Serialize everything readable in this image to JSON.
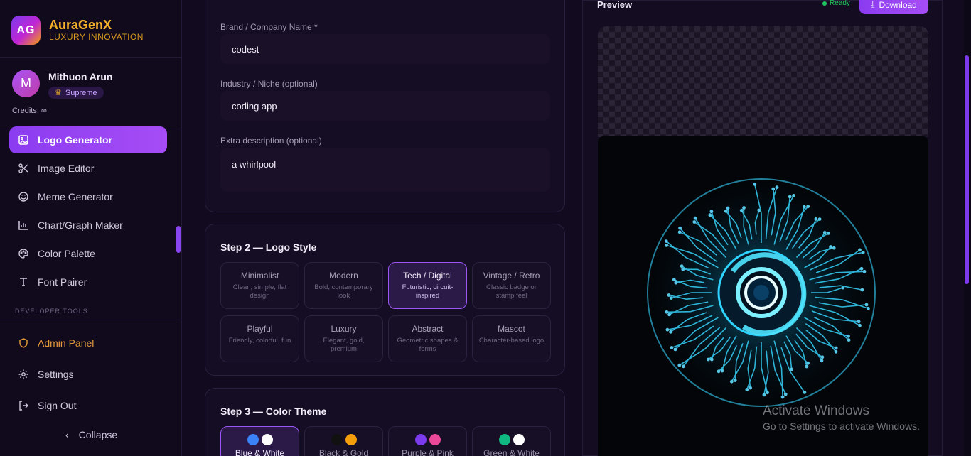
{
  "brand": {
    "logo_text": "AG",
    "name": "AuraGenX",
    "tagline": "LUXURY INNOVATION"
  },
  "user": {
    "initial": "M",
    "name": "Mithuon Arun",
    "badge": "Supreme",
    "credits": "Credits: ∞"
  },
  "nav": {
    "items": [
      {
        "label": "Logo Generator",
        "icon": "image-icon",
        "active": true
      },
      {
        "label": "Image Editor",
        "icon": "scissors-icon"
      },
      {
        "label": "Meme Generator",
        "icon": "smile-icon"
      },
      {
        "label": "Chart/Graph Maker",
        "icon": "bar-chart-icon"
      },
      {
        "label": "Color Palette",
        "icon": "palette-icon"
      },
      {
        "label": "Font Pairer",
        "icon": "type-icon"
      }
    ],
    "section_label": "DEVELOPER TOOLS",
    "bottom": [
      {
        "label": "Admin Panel",
        "icon": "shield-icon"
      },
      {
        "label": "Settings",
        "icon": "gear-icon"
      },
      {
        "label": "Sign Out",
        "icon": "sign-out-icon"
      }
    ],
    "collapse_label": "Collapse"
  },
  "form": {
    "brand_label": "Brand / Company Name *",
    "brand_value": "codest",
    "industry_label": "Industry / Niche (optional)",
    "industry_value": "coding app",
    "extra_label": "Extra description (optional)",
    "extra_value": "a whirlpool"
  },
  "step2": {
    "title": "Step 2 — Logo Style",
    "options": [
      {
        "title": "Minimalist",
        "desc": "Clean, simple, flat design"
      },
      {
        "title": "Modern",
        "desc": "Bold, contemporary look"
      },
      {
        "title": "Tech / Digital",
        "desc": "Futuristic, circuit-inspired",
        "selected": true
      },
      {
        "title": "Vintage / Retro",
        "desc": "Classic badge or stamp feel"
      },
      {
        "title": "Playful",
        "desc": "Friendly, colorful, fun"
      },
      {
        "title": "Luxury",
        "desc": "Elegant, gold, premium"
      },
      {
        "title": "Abstract",
        "desc": "Geometric shapes & forms"
      },
      {
        "title": "Mascot",
        "desc": "Character-based logo"
      }
    ]
  },
  "step3": {
    "title": "Step 3 — Color Theme",
    "themes": [
      {
        "label": "Blue & White",
        "colors": [
          "#3b82f6",
          "#ffffff"
        ],
        "selected": true
      },
      {
        "label": "Black & Gold",
        "colors": [
          "#111111",
          "#f59e0b"
        ]
      },
      {
        "label": "Purple & Pink",
        "colors": [
          "#7c3aed",
          "#ec4899"
        ]
      },
      {
        "label": "Green & White",
        "colors": [
          "#10b981",
          "#ffffff"
        ]
      }
    ]
  },
  "preview": {
    "title": "Preview",
    "status": "Ready",
    "download_label": "Download"
  },
  "watermark": {
    "line1": "Activate Windows",
    "line2": "Go to Settings to activate Windows."
  },
  "colors": {
    "accent": "#9b4cf2",
    "gold": "#f5b12a",
    "admin": "#e59a3a",
    "ready": "#22c55e"
  }
}
